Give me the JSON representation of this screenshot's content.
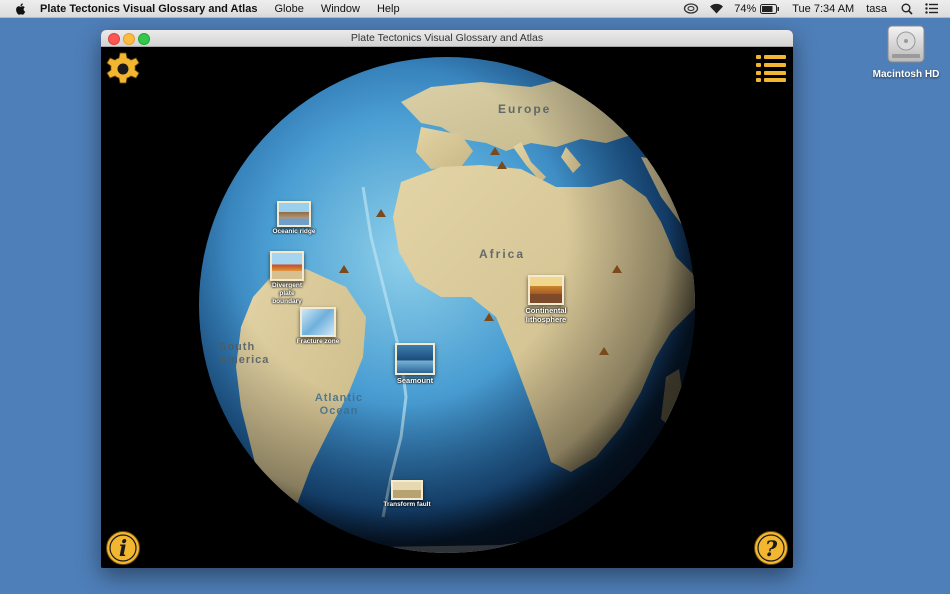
{
  "menubar": {
    "app_name": "Plate Tectonics Visual Glossary and Atlas",
    "menus": [
      "Globe",
      "Window",
      "Help"
    ],
    "battery_percent": "74%",
    "clock": "Tue 7:34 AM",
    "user": "tasa"
  },
  "desktop": {
    "drive_label": "Macintosh HD"
  },
  "window": {
    "title": "Plate Tectonics Visual Glossary and Atlas"
  },
  "globe": {
    "regions": [
      "Europe",
      "Africa",
      "South America",
      "Atlantic Ocean"
    ],
    "markers": [
      {
        "label": "Oceanic ridge"
      },
      {
        "label": "Divergent plate boundary"
      },
      {
        "label": "Fracture zone"
      },
      {
        "label": "Seamount"
      },
      {
        "label": "Continental lithosphere"
      },
      {
        "label": "Transform fault"
      }
    ]
  },
  "colors": {
    "button_gold": "#f2b631",
    "desktop_blue": "#4f7fb9",
    "ocean_deep": "#1e5d9c",
    "land": "#d9c99a"
  },
  "icons": {
    "settings": "gear-icon",
    "list": "list-icon",
    "info": "info-icon",
    "help": "help-icon"
  }
}
